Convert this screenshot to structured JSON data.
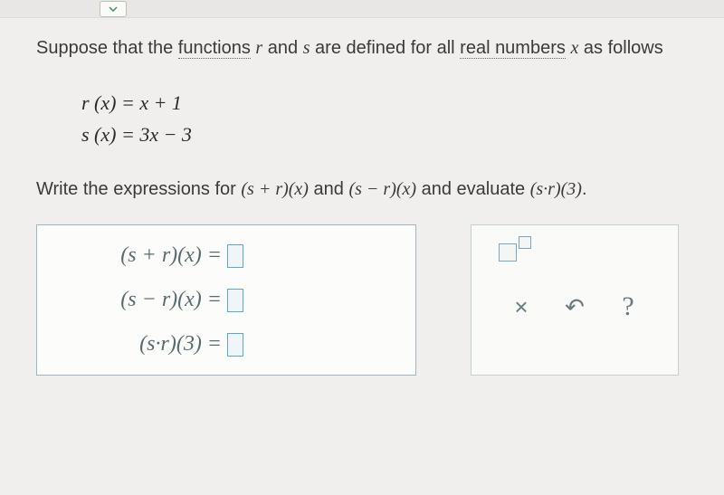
{
  "intro": {
    "prefix": "Suppose that the ",
    "link1": "functions",
    "mid1": " ",
    "var_r": "r",
    "mid2": " and ",
    "var_s": "s",
    "mid3": " are defined for all ",
    "link2": "real numbers",
    "mid4": " ",
    "var_x": "x",
    "suffix": " as follows"
  },
  "equations": {
    "line1": "r (x) = x + 1",
    "line2": "s (x) = 3x − 3"
  },
  "instruction": {
    "prefix": "Write the expressions for ",
    "expr1": "(s + r)(x)",
    "mid1": " and ",
    "expr2": "(s − r)(x)",
    "mid2": " and evaluate ",
    "expr3": "(s·r)(3)",
    "suffix": "."
  },
  "answers": {
    "line1": "(s + r)(x) = ",
    "line2": "(s − r)(x) = ",
    "line3": "(s·r)(3) = "
  },
  "tools": {
    "clear": "×",
    "reset": "↶",
    "help": "?"
  }
}
